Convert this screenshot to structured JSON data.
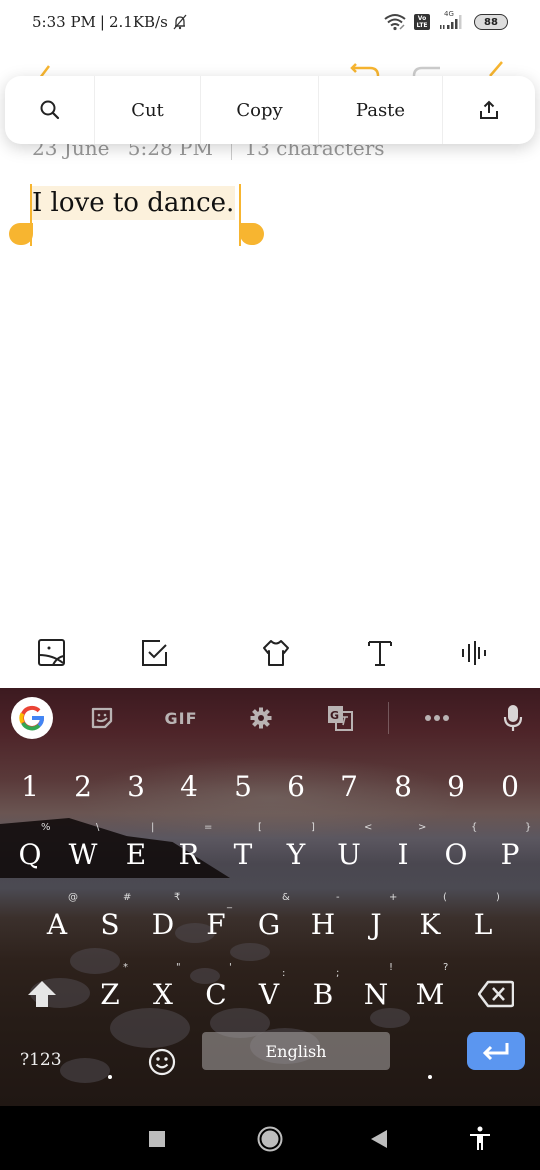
{
  "status_bar": {
    "time": "5:33 PM",
    "separator": "|",
    "net_speed": "2.1KB/s",
    "volte_label_top": "Vo",
    "volte_label_bottom": "LTE",
    "network_type": "4G",
    "battery": "88",
    "icons": [
      "alarm-off-icon",
      "wifi-icon",
      "volte-icon",
      "signal-icon",
      "battery-icon"
    ]
  },
  "context_menu": {
    "items": [
      {
        "name": "search",
        "icon": "search-icon"
      },
      {
        "name": "cut",
        "label": "Cut"
      },
      {
        "name": "copy",
        "label": "Copy"
      },
      {
        "name": "paste",
        "label": "Paste"
      },
      {
        "name": "share",
        "icon": "share-icon"
      }
    ]
  },
  "note": {
    "date": "23 June",
    "time": "5:28 PM",
    "char_count": "13 characters",
    "text": "I love to dance.",
    "selection_color": "#f7b530",
    "highlight_color": "#fcf1dc"
  },
  "editor_toolbar": {
    "items": [
      "image-icon",
      "checkbox-icon",
      "theme-shirt-icon",
      "text-format-icon",
      "voice-wave-icon"
    ]
  },
  "keyboard": {
    "toolbar": {
      "google": "G",
      "gif_label": "GIF",
      "icons": [
        "google-logo-icon",
        "sticker-icon",
        "gif-icon",
        "settings-icon",
        "translate-icon",
        "more-icon",
        "microphone-icon"
      ]
    },
    "number_row": [
      "1",
      "2",
      "3",
      "4",
      "5",
      "6",
      "7",
      "8",
      "9",
      "0"
    ],
    "row1": [
      {
        "key": "Q",
        "hint": "%"
      },
      {
        "key": "W",
        "hint": "\\"
      },
      {
        "key": "E",
        "hint": "|"
      },
      {
        "key": "R",
        "hint": "="
      },
      {
        "key": "T",
        "hint": "["
      },
      {
        "key": "Y",
        "hint": "]"
      },
      {
        "key": "U",
        "hint": "<"
      },
      {
        "key": "I",
        "hint": ">"
      },
      {
        "key": "O",
        "hint": "{"
      },
      {
        "key": "P",
        "hint": "}"
      }
    ],
    "row2": [
      {
        "key": "A",
        "hint": "@"
      },
      {
        "key": "S",
        "hint": "#"
      },
      {
        "key": "D",
        "hint": "₹"
      },
      {
        "key": "F",
        "hint": "_"
      },
      {
        "key": "G",
        "hint": "&"
      },
      {
        "key": "H",
        "hint": "-"
      },
      {
        "key": "J",
        "hint": "+"
      },
      {
        "key": "K",
        "hint": "("
      },
      {
        "key": "L",
        "hint": ")"
      }
    ],
    "row3": [
      {
        "key": "Z",
        "hint": "*"
      },
      {
        "key": "X",
        "hint": "\""
      },
      {
        "key": "C",
        "hint": "'"
      },
      {
        "key": "V",
        "hint": ":"
      },
      {
        "key": "B",
        "hint": ";"
      },
      {
        "key": "N",
        "hint": "!"
      },
      {
        "key": "M",
        "hint": "?"
      }
    ],
    "symbols_key": "?123",
    "space_label": "English",
    "enter_color": "#5b96f0"
  },
  "nav_bar": {
    "buttons": [
      "recents-button",
      "home-button",
      "back-button",
      "accessibility-button"
    ]
  }
}
